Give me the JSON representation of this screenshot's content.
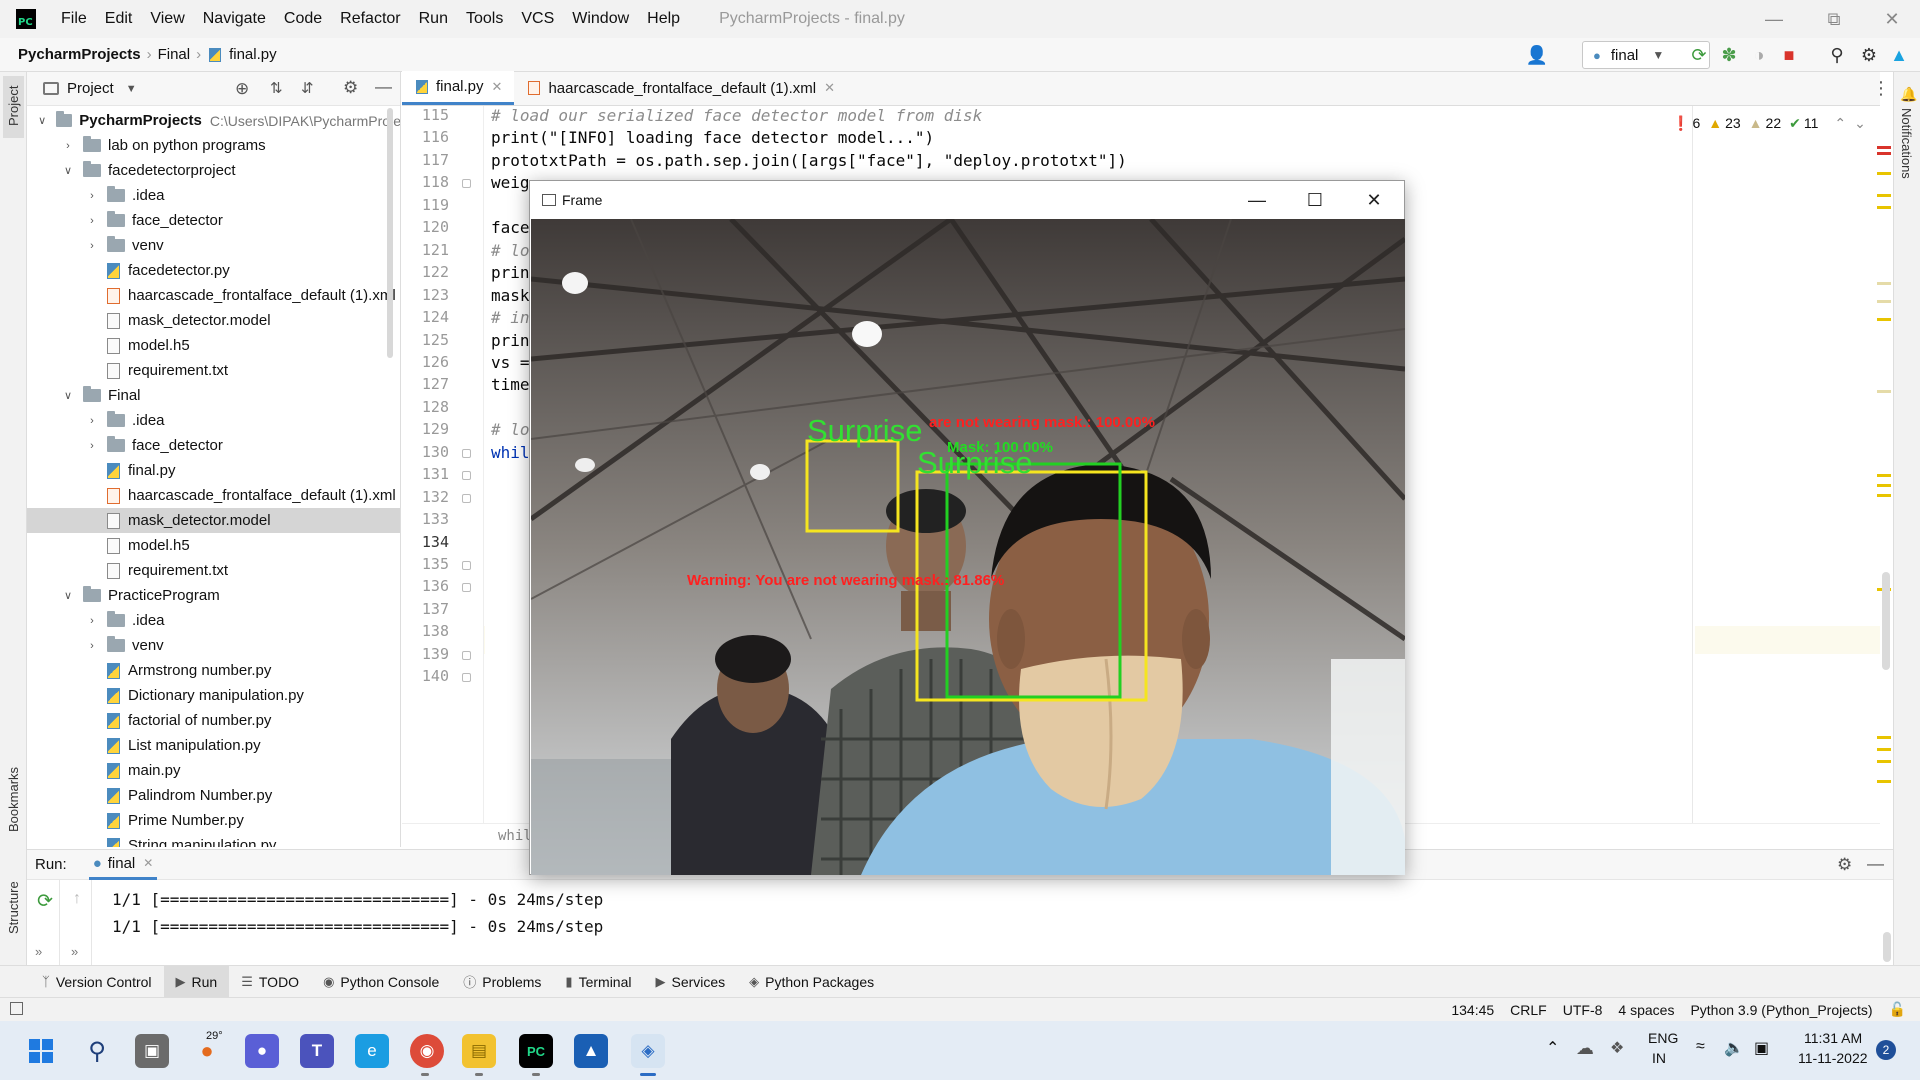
{
  "menubar": {
    "items": [
      "File",
      "Edit",
      "View",
      "Navigate",
      "Code",
      "Refactor",
      "Run",
      "Tools",
      "VCS",
      "Window",
      "Help"
    ],
    "window_title": "PycharmProjects - final.py"
  },
  "navbar": {
    "crumbs": [
      "PycharmProjects",
      "Final",
      "final.py"
    ],
    "run_config": "final"
  },
  "left_strip": {
    "project": "Project",
    "bookmarks": "Bookmarks",
    "structure": "Structure"
  },
  "right_strip": {
    "notifications": "Notifications"
  },
  "project": {
    "title": "Project",
    "tree": [
      {
        "label": "PycharmProjects",
        "path": "C:\\Users\\DIPAK\\PycharmProje",
        "type": "root"
      },
      {
        "label": "lab on python programs",
        "type": "folder"
      },
      {
        "label": "facedetectorproject",
        "type": "folder"
      },
      {
        "label": ".idea",
        "type": "folder"
      },
      {
        "label": "face_detector",
        "type": "folder"
      },
      {
        "label": "venv",
        "type": "folder"
      },
      {
        "label": "facedetector.py",
        "type": "py"
      },
      {
        "label": "haarcascade_frontalface_default (1).xml",
        "type": "xml"
      },
      {
        "label": "mask_detector.model",
        "type": "file"
      },
      {
        "label": "model.h5",
        "type": "file"
      },
      {
        "label": "requirement.txt",
        "type": "file"
      },
      {
        "label": "Final",
        "type": "folder"
      },
      {
        "label": ".idea",
        "type": "folder"
      },
      {
        "label": "face_detector",
        "type": "folder"
      },
      {
        "label": "final.py",
        "type": "py"
      },
      {
        "label": "haarcascade_frontalface_default (1).xml",
        "type": "xml"
      },
      {
        "label": "mask_detector.model",
        "type": "file"
      },
      {
        "label": "model.h5",
        "type": "file"
      },
      {
        "label": "requirement.txt",
        "type": "file"
      },
      {
        "label": "PracticeProgram",
        "type": "folder"
      },
      {
        "label": ".idea",
        "type": "folder"
      },
      {
        "label": "venv",
        "type": "folder"
      },
      {
        "label": "Armstrong number.py",
        "type": "py"
      },
      {
        "label": "Dictionary manipulation.py",
        "type": "py"
      },
      {
        "label": "factorial of number.py",
        "type": "py"
      },
      {
        "label": "List manipulation.py",
        "type": "py"
      },
      {
        "label": "main.py",
        "type": "py"
      },
      {
        "label": "Palindrom Number.py",
        "type": "py"
      },
      {
        "label": "Prime Number.py",
        "type": "py"
      },
      {
        "label": "String manipulation.py",
        "type": "py"
      }
    ]
  },
  "editor": {
    "tabs": [
      "final.py",
      "haarcascade_frontalface_default (1).xml"
    ],
    "line_numbers": [
      "115",
      "116",
      "117",
      "118",
      "119",
      "120",
      "121",
      "122",
      "123",
      "124",
      "125",
      "126",
      "127",
      "128",
      "129",
      "130",
      "131",
      "132",
      "133",
      "134",
      "135",
      "136",
      "137",
      "138",
      "139",
      "140"
    ],
    "lines": [
      {
        "text": "# load our serialized face detector model from disk",
        "kind": "cmt"
      },
      {
        "text": "print(\"[INFO] loading face detector model...\")",
        "kind": "code"
      },
      {
        "text": "prototxtPath = os.path.sep.join([args[\"face\"], \"deploy.prototxt\"])",
        "kind": "code"
      },
      {
        "text": "weig",
        "kind": "code"
      },
      {
        "text": "",
        "kind": "code"
      },
      {
        "text": "face",
        "kind": "code"
      },
      {
        "text": "# lo",
        "kind": "cmt"
      },
      {
        "text": "prin",
        "kind": "code"
      },
      {
        "text": "mask",
        "kind": "code"
      },
      {
        "text": "# in",
        "kind": "cmt"
      },
      {
        "text": "prin",
        "kind": "code"
      },
      {
        "text": "vs =",
        "kind": "code"
      },
      {
        "text": "time",
        "kind": "code"
      },
      {
        "text": "",
        "kind": "code"
      },
      {
        "text": "# lo",
        "kind": "cmt"
      },
      {
        "text": "whil",
        "kind": "kw"
      }
    ],
    "breadcrumb": "while",
    "inspections": {
      "errors": "6",
      "warnings": "23",
      "weak_warnings": "22",
      "ok": "11"
    }
  },
  "run": {
    "label": "Run:",
    "tab": "final",
    "output": [
      "1/1 [==============================] - 0s 24ms/step",
      "1/1 [==============================] - 0s 24ms/step"
    ]
  },
  "tool_tabs": [
    "Version Control",
    "Run",
    "TODO",
    "Python Console",
    "Problems",
    "Terminal",
    "Services",
    "Python Packages"
  ],
  "statusbar": {
    "position": "134:45",
    "line_sep": "CRLF",
    "encoding": "UTF-8",
    "indent": "4 spaces",
    "interpreter": "Python 3.9 (Python_Projects)"
  },
  "frame_window": {
    "title": "Frame",
    "overlays": {
      "emotion_1": "Surprise",
      "emotion_2": "Surprise",
      "warning_top": "are not wearing mask.: 100.00%",
      "mask_label": "Mask: 100.00%",
      "warning_mid": "Warning: You are not wearing mask.: 81.86%"
    }
  },
  "taskbar": {
    "weather": "29°",
    "language": "ENG",
    "region": "IN",
    "time": "11:31 AM",
    "date": "11-11-2022",
    "notification_count": "2"
  }
}
